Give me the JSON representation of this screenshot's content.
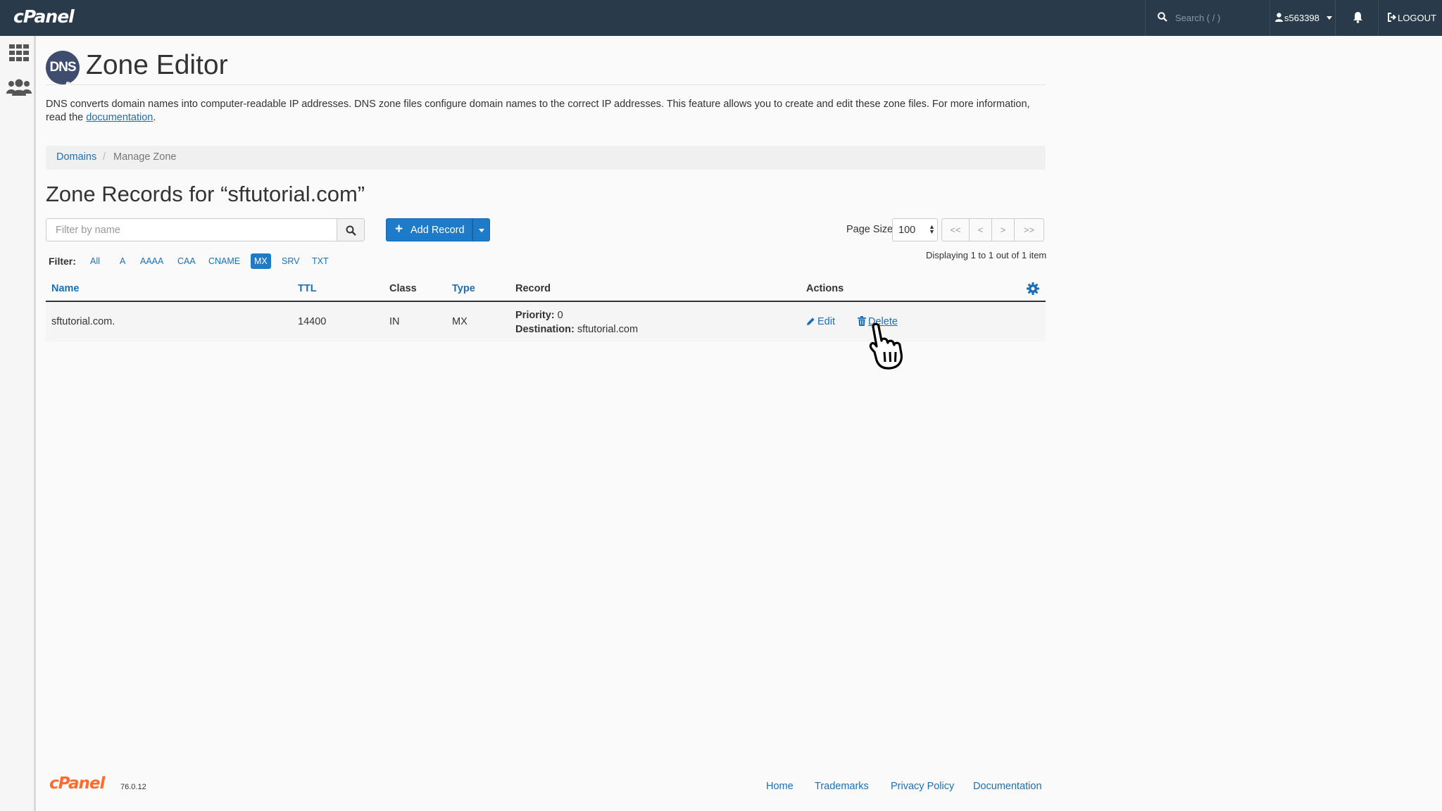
{
  "topbar": {
    "logo": "cPanel",
    "search_placeholder": "Search ( / )",
    "username": "s563398",
    "logout": "LOGOUT"
  },
  "page": {
    "title": "Zone Editor",
    "icon_text": "DNS",
    "description_pre": "DNS converts domain names into computer-readable IP addresses. DNS zone files configure domain names to the correct IP addresses. This feature allows you to create and edit these zone files. For more information, read the",
    "description_link": "documentation",
    "description_post": "."
  },
  "breadcrumb": {
    "link": "Domains",
    "separator": "/",
    "current": "Manage Zone"
  },
  "zone": {
    "title": "Zone Records for “sftutorial.com”"
  },
  "toolbar": {
    "filter_placeholder": "Filter by name",
    "add_record": "Add Record",
    "page_size_label": "Page Size",
    "page_size": "100",
    "pager": {
      "first": "<<",
      "prev": "<",
      "next": ">",
      "last": ">>"
    },
    "displaying": "Displaying 1 to 1 out of 1 item"
  },
  "filters": {
    "label": "Filter:",
    "options": [
      "All",
      "A",
      "AAAA",
      "CAA",
      "CNAME",
      "MX",
      "SRV",
      "TXT"
    ],
    "active": "MX"
  },
  "table": {
    "headers": {
      "name": "Name",
      "ttl": "TTL",
      "class": "Class",
      "type": "Type",
      "record": "Record",
      "actions": "Actions"
    },
    "rows": [
      {
        "name": "sftutorial.com.",
        "ttl": "14400",
        "class": "IN",
        "type": "MX",
        "priority_label": "Priority:",
        "priority": "0",
        "destination_label": "Destination:",
        "destination": "sftutorial.com",
        "edit": "Edit",
        "delete": "Delete"
      }
    ]
  },
  "footer": {
    "logo": "cPanel",
    "version": "76.0.12",
    "links": [
      "Home",
      "Trademarks",
      "Privacy Policy",
      "Documentation"
    ]
  },
  "colors": {
    "topbar": "#293a4a",
    "accent": "#1f7bc7",
    "footer_logo": "#ff6c2c"
  }
}
